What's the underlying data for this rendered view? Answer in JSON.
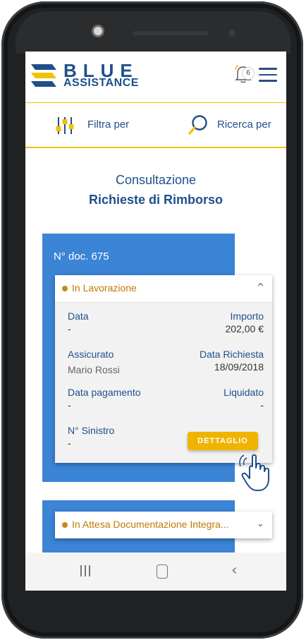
{
  "header": {
    "logo_word": "BLUE",
    "logo_sub": "ASSISTANCE",
    "notification_count": "6"
  },
  "toolbar": {
    "filter_label": "Filtra per",
    "search_label": "Ricerca per"
  },
  "page": {
    "title_line1": "Consultazione",
    "title_line2": "Richieste di Rimborso"
  },
  "requests": [
    {
      "doc_number": "N° doc. 675",
      "status": "In Lavorazione",
      "expanded": true,
      "fields": {
        "data_label": "Data",
        "data_value": "-",
        "importo_label": "Importo",
        "importo_value": "202,00 €",
        "assicurato_label": "Assicurato",
        "assicurato_value": "Mario Rossi",
        "data_richiesta_label": "Data Richiesta",
        "data_richiesta_value": "18/09/2018",
        "data_pagamento_label": "Data pagamento",
        "data_pagamento_value": "-",
        "liquidato_label": "Liquidato",
        "liquidato_value": "-",
        "sinistro_label": "N° Sinistro",
        "sinistro_value": "-"
      },
      "detail_button": "DETTAGLIO"
    },
    {
      "status": "In Attesa Documentazione Integra...",
      "expanded": false
    }
  ],
  "colors": {
    "brand_blue": "#1f4f8a",
    "card_blue": "#3b84d6",
    "accent_yellow": "#f2c200",
    "status_orange": "#c07a00"
  }
}
